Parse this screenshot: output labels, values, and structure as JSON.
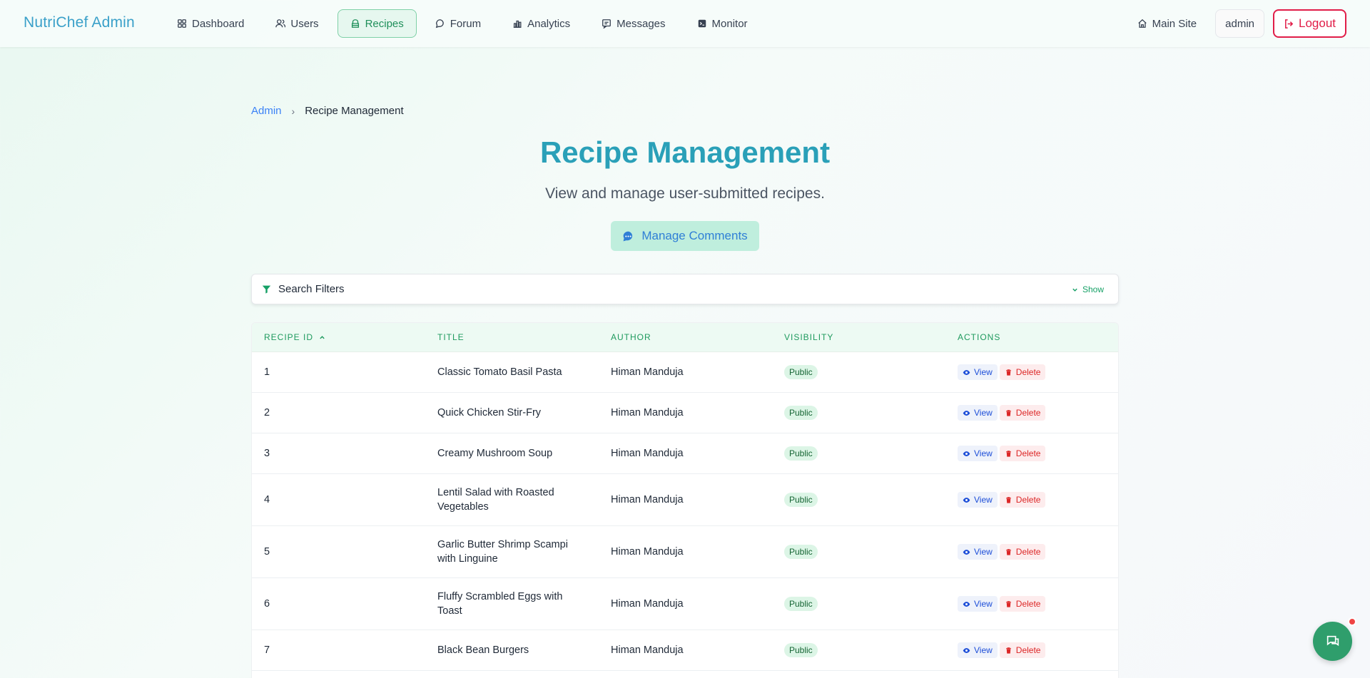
{
  "brand": "NutriChef Admin",
  "nav": [
    {
      "label": "Dashboard",
      "icon": "dashboard-icon"
    },
    {
      "label": "Users",
      "icon": "users-icon"
    },
    {
      "label": "Recipes",
      "icon": "recipes-icon",
      "active": true
    },
    {
      "label": "Forum",
      "icon": "forum-icon"
    },
    {
      "label": "Analytics",
      "icon": "analytics-icon"
    },
    {
      "label": "Messages",
      "icon": "messages-icon"
    },
    {
      "label": "Monitor",
      "icon": "monitor-icon"
    }
  ],
  "header_right": {
    "main_site": "Main Site",
    "user": "admin",
    "logout": "Logout"
  },
  "breadcrumb": {
    "root": "Admin",
    "current": "Recipe Management"
  },
  "page": {
    "title": "Recipe Management",
    "subtitle": "View and manage user-submitted recipes.",
    "manage_comments": "Manage Comments"
  },
  "filters": {
    "label": "Search Filters",
    "toggle": "Show"
  },
  "table": {
    "columns": [
      "RECIPE ID",
      "TITLE",
      "AUTHOR",
      "VISIBILITY",
      "ACTIONS"
    ],
    "action_labels": {
      "view": "View",
      "delete": "Delete"
    },
    "rows": [
      {
        "id": "1",
        "title": "Classic Tomato Basil Pasta",
        "author": "Himan Manduja",
        "visibility": "Public"
      },
      {
        "id": "2",
        "title": "Quick Chicken Stir-Fry",
        "author": "Himan Manduja",
        "visibility": "Public"
      },
      {
        "id": "3",
        "title": "Creamy Mushroom Soup",
        "author": "Himan Manduja",
        "visibility": "Public"
      },
      {
        "id": "4",
        "title": "Lentil Salad with Roasted Vegetables",
        "author": "Himan Manduja",
        "visibility": "Public"
      },
      {
        "id": "5",
        "title": "Garlic Butter Shrimp Scampi with Linguine",
        "author": "Himan Manduja",
        "visibility": "Public"
      },
      {
        "id": "6",
        "title": "Fluffy Scrambled Eggs with Toast",
        "author": "Himan Manduja",
        "visibility": "Public"
      },
      {
        "id": "7",
        "title": "Black Bean Burgers",
        "author": "Himan Manduja",
        "visibility": "Public"
      }
    ]
  },
  "colors": {
    "brand": "#3aa0c9",
    "title": "#2aa0b8",
    "accent_green": "#1f9a5e",
    "danger": "#e11d48",
    "link": "#3b82f6"
  }
}
